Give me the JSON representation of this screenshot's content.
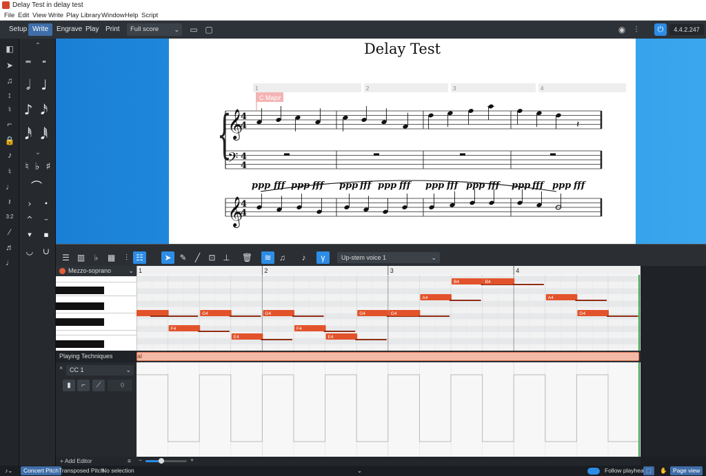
{
  "window": {
    "title": "Delay Test in delay test"
  },
  "menu": [
    "File",
    "Edit",
    "View",
    "Write",
    "Play",
    "Library",
    "Window",
    "Help",
    "Script"
  ],
  "modes": [
    {
      "label": "Setup",
      "active": false
    },
    {
      "label": "Write",
      "active": true
    },
    {
      "label": "Engrave",
      "active": false
    },
    {
      "label": "Play",
      "active": false
    },
    {
      "label": "Print",
      "active": false
    }
  ],
  "layout_select": {
    "value": "Full score"
  },
  "version": "4.4.2.247",
  "score": {
    "title": "Delay Test",
    "key_signature_label": "C Major",
    "bar_numbers": [
      "1",
      "2",
      "3",
      "4"
    ],
    "dynamics": [
      "ppp",
      "fff",
      "ppp",
      "fff",
      "ppp",
      "fff",
      "ppp",
      "fff",
      "ppp",
      "fff",
      "ppp",
      "fff",
      "ppp",
      "fff",
      "ppp",
      "fff"
    ],
    "time_signature": "4/4"
  },
  "key_editor": {
    "voice_select": "Up-stem voice 1",
    "instrument": "Mezzo-soprano",
    "instrument_color": "#e35d3a",
    "bars": [
      "1",
      "2",
      "3",
      "4"
    ],
    "notes": [
      {
        "pitch": "G4",
        "bar": 1,
        "beat": 0
      },
      {
        "pitch": "F4",
        "bar": 1,
        "beat": 1
      },
      {
        "pitch": "G4",
        "bar": 1,
        "beat": 2
      },
      {
        "pitch": "E4",
        "bar": 1,
        "beat": 3
      },
      {
        "pitch": "G4",
        "bar": 2,
        "beat": 0
      },
      {
        "pitch": "F4",
        "bar": 2,
        "beat": 1
      },
      {
        "pitch": "E4",
        "bar": 2,
        "beat": 2
      },
      {
        "pitch": "G4",
        "bar": 2,
        "beat": 3
      },
      {
        "pitch": "G4",
        "bar": 3,
        "beat": 0
      },
      {
        "pitch": "A4",
        "bar": 3,
        "beat": 1
      },
      {
        "pitch": "B4",
        "bar": 3,
        "beat": 2
      },
      {
        "pitch": "B4",
        "bar": 3,
        "beat": 3
      },
      {
        "pitch": "A4",
        "bar": 4,
        "beat": 1
      },
      {
        "pitch": "G4",
        "bar": 4,
        "beat": 2
      }
    ],
    "playing_techniques_label": "Playing Techniques",
    "playing_technique_value": "al",
    "cc_select": "CC 1",
    "cc_value": "0",
    "add_editor_label": "+ Add Editor",
    "note_color": "#e2532b"
  },
  "status": {
    "concert_pitch": "Concert Pitch",
    "transposed_pitch": "Transposed Pitch",
    "selection": "No selection",
    "follow_playhead": "Follow playhead",
    "page_view": "Page view"
  }
}
